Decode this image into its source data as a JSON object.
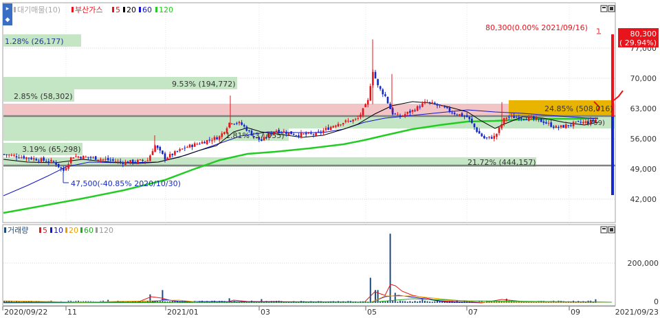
{
  "colors": {
    "up": "#e8141c",
    "down": "#1428c8",
    "ma5": "#e8141c",
    "ma20": "#000000",
    "ma60": "#1414c8",
    "ma120": "#22cc22",
    "band_green": "#c4e6c4",
    "band_pink": "#f2c4c6",
    "band_gold": "#e8b400",
    "grid": "#d4d4d4",
    "vol_bar": "#1e4a7c"
  },
  "price_panel": {
    "legend": {
      "volume_profile_label": "대기매물(10)",
      "stock_label": "부산가스",
      "ma_items": [
        "5",
        "20",
        "60",
        "120"
      ]
    },
    "y_ticks": [
      "77,000",
      "70,000",
      "63,000",
      "56,000",
      "49,000",
      "42,000"
    ],
    "current_price_tag": {
      "price": "80,300",
      "change": "( 29.94%)"
    },
    "annotations": {
      "high_label": "80,300(0.00% 2021/09/16)",
      "low_label": "47,500(-40.85% 2020/10/30)"
    },
    "profile_labels": [
      "1.28% (26,177)",
      "9.53% (194,772)",
      "2.85% (58,302)",
      "24.85% (508,016)",
      "1.81% (37,055)",
      "3.19% (65,298)",
      "21.72% (444,157)",
      "(759)"
    ]
  },
  "volume_panel": {
    "legend": {
      "label": "거래량",
      "ma_items": [
        "5",
        "10",
        "20",
        "60",
        "120"
      ],
      "ma_colors": [
        "#e8141c",
        "#1414c8",
        "#e8a000",
        "#22aa22",
        "#999999"
      ]
    },
    "y_ticks": [
      "200,000",
      "0"
    ]
  },
  "x_ticks": [
    "2020/09/22",
    "11",
    "2021/01",
    "03",
    "05",
    "07",
    "09",
    "2021/09/23"
  ],
  "chart_data": {
    "type": "candlestick",
    "stock": "부산가스",
    "x_start": "2020/09/22",
    "x_end": "2021/09/23",
    "ylim": [
      36000,
      81500
    ],
    "price_tick_values": [
      77000,
      70000,
      63000,
      56000,
      49000,
      42000
    ],
    "moving_averages": [
      "5",
      "20",
      "60",
      "120"
    ],
    "candles": [
      {
        "x": "2020/10",
        "close": 51500
      },
      {
        "x": "2020/10/30",
        "close": 48500,
        "low": 47500
      },
      {
        "x": "2020/12",
        "close": 50500
      },
      {
        "x": "2021/01",
        "close": 52500
      },
      {
        "x": "2021/02",
        "close": 57000
      },
      {
        "x": "2021/03",
        "close": 57500
      },
      {
        "x": "2021/04",
        "close": 57000
      },
      {
        "x": "2021/05",
        "close": 62000
      },
      {
        "x": "2021/06",
        "close": 62500
      },
      {
        "x": "2021/07",
        "close": 56000
      },
      {
        "x": "2021/08",
        "close": 59500
      },
      {
        "x": "2021/09/16",
        "close": 80300,
        "high": 80300
      }
    ],
    "volume_profile": [
      {
        "label": "1.28% (26,177)",
        "pct": 1.28,
        "volume": 26177
      },
      {
        "label": "9.53% (194,772)",
        "pct": 9.53,
        "volume": 194772
      },
      {
        "label": "2.85% (58,302)",
        "pct": 2.85,
        "volume": 58302
      },
      {
        "label": "24.85% (508,016)",
        "pct": 24.85,
        "volume": 508016
      },
      {
        "label": "1.81% (37,055)",
        "pct": 1.81,
        "volume": 37055
      },
      {
        "label": "3.19% (65,298)",
        "pct": 3.19,
        "volume": 65298
      },
      {
        "label": "21.72% (444,157)",
        "pct": 21.72,
        "volume": 444157
      }
    ],
    "volume_ticks": [
      200000,
      0
    ]
  }
}
